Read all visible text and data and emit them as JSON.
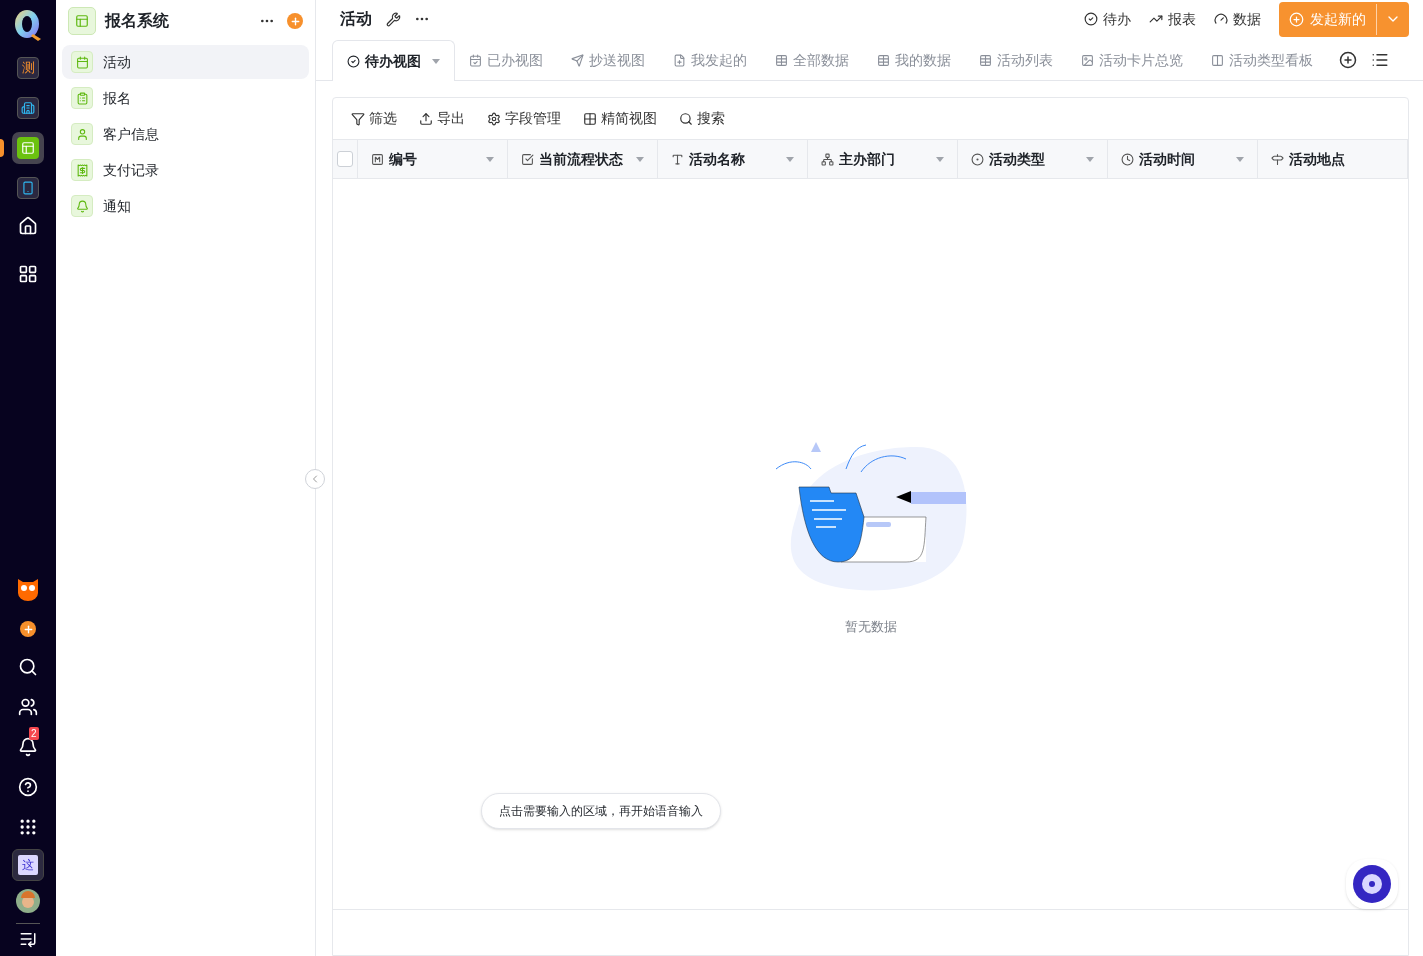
{
  "rail": {
    "apps": [
      {
        "kind": "text",
        "label": "测",
        "selected": false
      },
      {
        "kind": "building",
        "selected": false
      },
      {
        "kind": "layout",
        "selected": true
      },
      {
        "kind": "device",
        "selected": false
      }
    ],
    "notification_badge": "2",
    "workspace_tile": "这"
  },
  "sidebar": {
    "title": "报名系统",
    "items": [
      {
        "label": "活动",
        "selected": true
      },
      {
        "label": "报名",
        "selected": false
      },
      {
        "label": "客户信息",
        "selected": false
      },
      {
        "label": "支付记录",
        "selected": false
      },
      {
        "label": "通知",
        "selected": false
      }
    ]
  },
  "header": {
    "title": "活动",
    "actions": [
      "待办",
      "报表",
      "数据"
    ],
    "primary_button": "发起新的"
  },
  "tabs": [
    {
      "label": "待办视图",
      "selected": true
    },
    {
      "label": "已办视图",
      "selected": false
    },
    {
      "label": "抄送视图",
      "selected": false
    },
    {
      "label": "我发起的",
      "selected": false
    },
    {
      "label": "全部数据",
      "selected": false
    },
    {
      "label": "我的数据",
      "selected": false
    },
    {
      "label": "活动列表",
      "selected": false
    },
    {
      "label": "活动卡片总览",
      "selected": false
    },
    {
      "label": "活动类型看板",
      "selected": false
    }
  ],
  "toolbar": [
    "筛选",
    "导出",
    "字段管理",
    "精简视图",
    "搜索"
  ],
  "table": {
    "select_all_checked": false,
    "columns": [
      "编号",
      "当前流程状态",
      "活动名称",
      "主办部门",
      "活动类型",
      "活动时间",
      "活动地点"
    ],
    "empty_text": "暂无数据"
  },
  "voice_hint": "点击需要输入的区域，再开始语音输入"
}
